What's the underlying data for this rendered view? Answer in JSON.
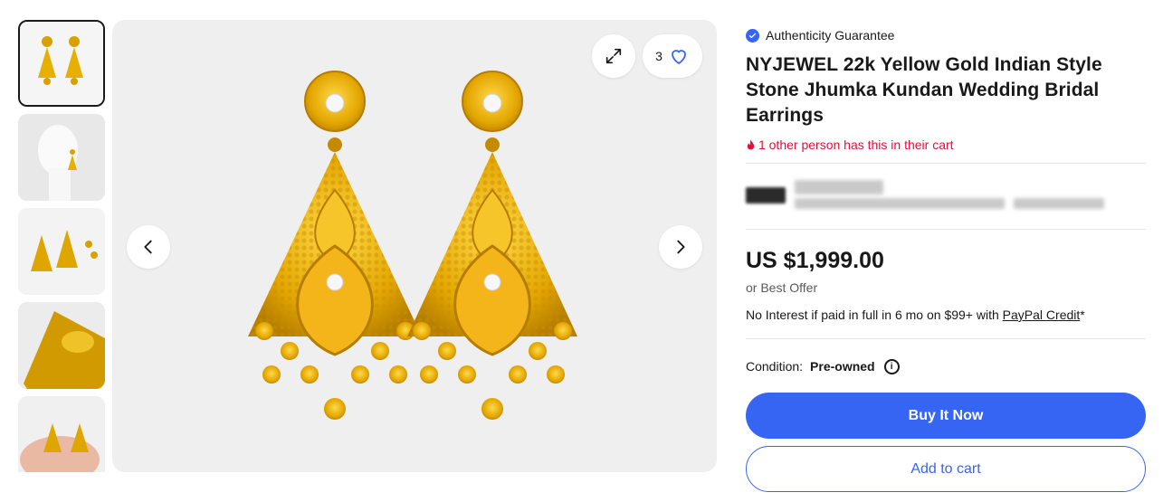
{
  "colors": {
    "primary_blue": "#3665f3",
    "urgency_red": "#e0103a",
    "gold": "#e1a800",
    "image_bg": "#efefef"
  },
  "gallery": {
    "thumbnail_count": 5,
    "selected_index": 0,
    "watch_count": "3",
    "icons": {
      "expand": "expand-icon",
      "heart": "heart-icon",
      "prev": "chevron-left-icon",
      "next": "chevron-right-icon"
    }
  },
  "listing": {
    "authenticity_label": "Authenticity Guarantee",
    "title": "NYJEWEL 22k Yellow Gold Indian Style Stone Jhumka Kundan Wedding Bridal Earrings",
    "cart_note": "1 other person has this in their cart",
    "price": "US $1,999.00",
    "best_offer": "or Best Offer",
    "credit_text": "No Interest if paid in full in 6 mo on $99+ with ",
    "credit_link": "PayPal Credit",
    "credit_suffix": "*",
    "condition_label": "Condition:",
    "condition_value": "Pre-owned",
    "buy_now_label": "Buy It Now",
    "add_to_cart_label": "Add to cart"
  }
}
